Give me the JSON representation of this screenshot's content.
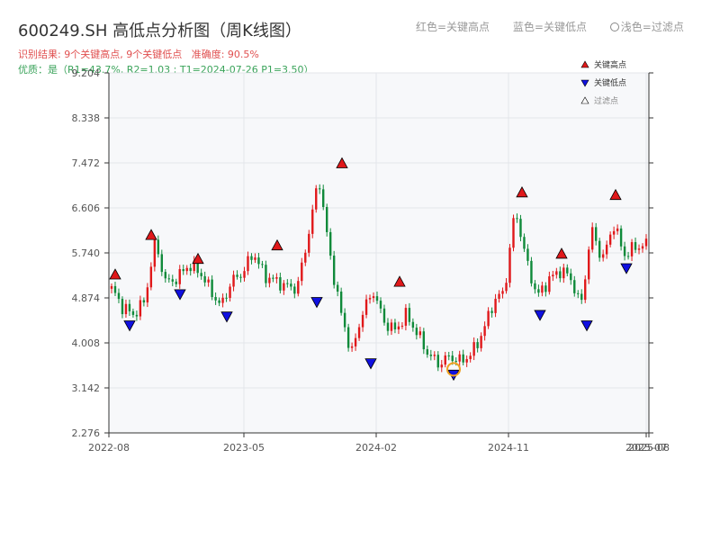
{
  "title": "600249.SH 高低点分析图（周K线图）",
  "legend_top": {
    "red_label": "红色=关键高点",
    "blue_label": "蓝色=关键低点",
    "filtered_label": "浅色=过滤点"
  },
  "result_text": "识别结果: 9个关键高点, 9个关键低点",
  "accuracy_text": "准确度: 90.5%",
  "quality_text": "优质：是（R1=43.7%, R2=1.03 ; T1=2024-07-26 P1=3.50）",
  "colors": {
    "up": "#e0181a",
    "down": "#0f8a3a",
    "high_marker": "#e0181a",
    "low_marker": "#1010e0",
    "filtered": "#f0a020",
    "plot_bg": "#f7f8fa",
    "grid": "#e3e6ea"
  },
  "chart_data": {
    "type": "candlestick",
    "y_ticks": [
      "2.276",
      "3.142",
      "4.008",
      "4.874",
      "5.740",
      "6.606",
      "7.472",
      "8.338",
      "9.204"
    ],
    "ylim": [
      2.276,
      9.204
    ],
    "x_ticks": [
      "2022-08",
      "2023-05",
      "2024-02",
      "2024-11",
      "2025-07",
      "2025-08"
    ],
    "grid": true,
    "legend": {
      "position": "top-right",
      "items": [
        {
          "label": "关键高点",
          "marker": "triangle-up",
          "color": "#e0181a"
        },
        {
          "label": "关键低点",
          "marker": "triangle-down",
          "color": "#1010e0"
        },
        {
          "label": "过滤点",
          "marker": "triangle-up",
          "color": "#ffffff"
        }
      ]
    },
    "key_highs": [
      5.22,
      5.98,
      5.52,
      5.78,
      7.36,
      5.08,
      6.8,
      5.62,
      6.75
    ],
    "key_lows": [
      4.45,
      5.05,
      4.62,
      4.9,
      3.72,
      3.5,
      4.65,
      4.45,
      5.55
    ],
    "filtered_point": {
      "label": "2024-07-26",
      "value": 3.5
    },
    "waypoints": [
      5.05,
      4.7,
      4.55,
      4.8,
      5.95,
      5.15,
      5.25,
      5.5,
      5.4,
      5.05,
      4.7,
      5.2,
      5.35,
      5.75,
      5.3,
      5.2,
      5.1,
      5.05,
      6.05,
      7.2,
      5.7,
      4.6,
      3.8,
      4.6,
      5.0,
      4.4,
      4.25,
      4.55,
      4.2,
      3.8,
      3.6,
      3.75,
      3.65,
      3.8,
      4.2,
      4.8,
      5.0,
      6.6,
      5.6,
      4.9,
      5.2,
      5.4,
      5.3,
      4.7,
      6.2,
      5.6,
      6.3,
      5.7,
      5.85,
      5.9
    ]
  }
}
